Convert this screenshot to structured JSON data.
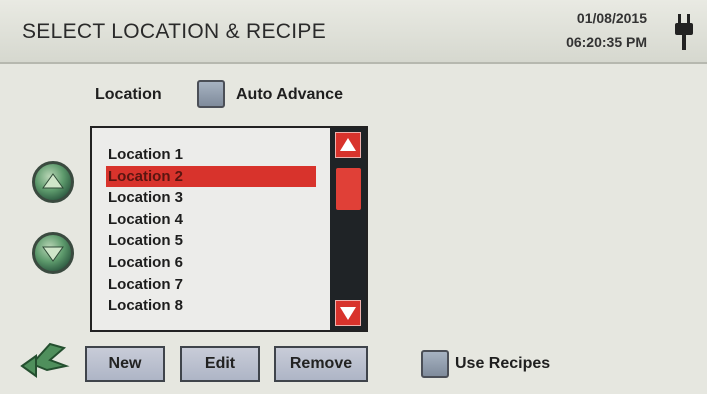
{
  "header": {
    "title": "SELECT LOCATION & RECIPE",
    "date": "01/08/2015",
    "time": "06:20:35 PM",
    "icon": "power-plug-icon"
  },
  "location_section": {
    "label": "Location",
    "auto_advance_label": "Auto Advance",
    "auto_advance_checked": false
  },
  "list": {
    "items": [
      "Location 1",
      "Location 2",
      "Location 3",
      "Location 4",
      "Location 5",
      "Location 6",
      "Location 7",
      "Location 8"
    ],
    "selected_index": 1
  },
  "nav": {
    "up_icon": "arrow-up-icon",
    "down_icon": "arrow-down-icon",
    "back_icon": "back-arrow-icon"
  },
  "buttons": {
    "new": "New",
    "edit": "Edit",
    "remove": "Remove"
  },
  "recipes": {
    "label": "Use Recipes",
    "checked": false
  },
  "colors": {
    "accent": "#d8332c",
    "background": "#e6e7e0",
    "header": "#d6d8cf"
  }
}
